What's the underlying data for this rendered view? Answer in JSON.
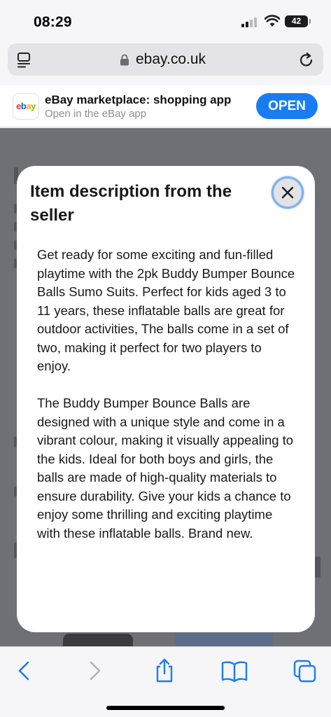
{
  "status_bar": {
    "time": "08:29",
    "battery": "42"
  },
  "url_bar": {
    "url": "ebay.co.uk"
  },
  "app_banner": {
    "title": "eBay marketplace: shopping app",
    "subtitle": "Open in the eBay app",
    "open_label": "OPEN",
    "logo_text": "ebay"
  },
  "modal": {
    "title": "Item description from the seller",
    "paragraphs": [
      "Get ready for some exciting and fun-filled playtime with the 2pk Buddy Bumper Bounce Balls Sumo Suits. Perfect for kids aged 3 to 11 years, these inflatable balls are great for outdoor activities,  The balls come in a set of two, making it perfect for two players to enjoy.",
      "The Buddy Bumper Bounce Balls are designed with a unique style and come in a vibrant colour, making it visually appealing to the kids. Ideal for both boys and girls, the balls are made of high-quality materials to ensure durability. Give your kids a chance to enjoy some thrilling and exciting playtime with these inflatable balls. Brand new."
    ]
  },
  "icons": {
    "reader": "reader-icon",
    "lock": "lock-icon",
    "reload": "reload-icon",
    "close": "close-icon",
    "back": "back-arrow-icon",
    "forward": "forward-arrow-icon",
    "share": "share-icon",
    "bookmarks": "book-icon",
    "tabs": "tabs-icon"
  },
  "colors": {
    "accent": "#1a7cf3",
    "toolbar_icon": "#1a7cf3",
    "overlay": "#6f7075"
  }
}
